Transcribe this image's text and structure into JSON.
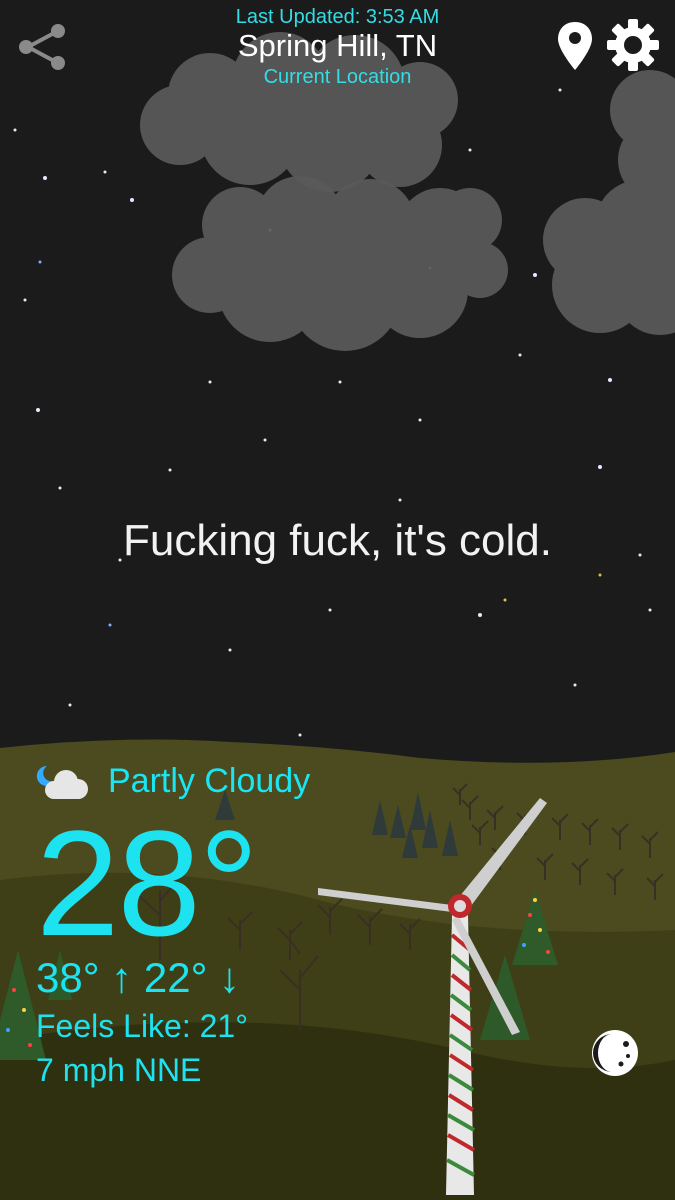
{
  "header": {
    "last_updated": "Last Updated: 3:53 AM",
    "city": "Spring Hill, TN",
    "location_label": "Current Location"
  },
  "icons": {
    "share": "share-icon",
    "location": "location-pin-icon",
    "settings": "gear-icon",
    "condition": "partly-cloudy-night-icon",
    "moon": "moon-phase-icon"
  },
  "message": "Fucking fuck, it's cold.",
  "weather": {
    "condition": "Partly Cloudy",
    "temperature": "28°",
    "high_low": "38° ↑  22° ↓",
    "feels_like": "Feels Like: 21°",
    "wind": "7 mph NNE"
  },
  "colors": {
    "sky": "#1b1b1b",
    "accent": "#1de3f0",
    "hill": "#4a4a1e",
    "cloud": "#5b5b5b"
  }
}
